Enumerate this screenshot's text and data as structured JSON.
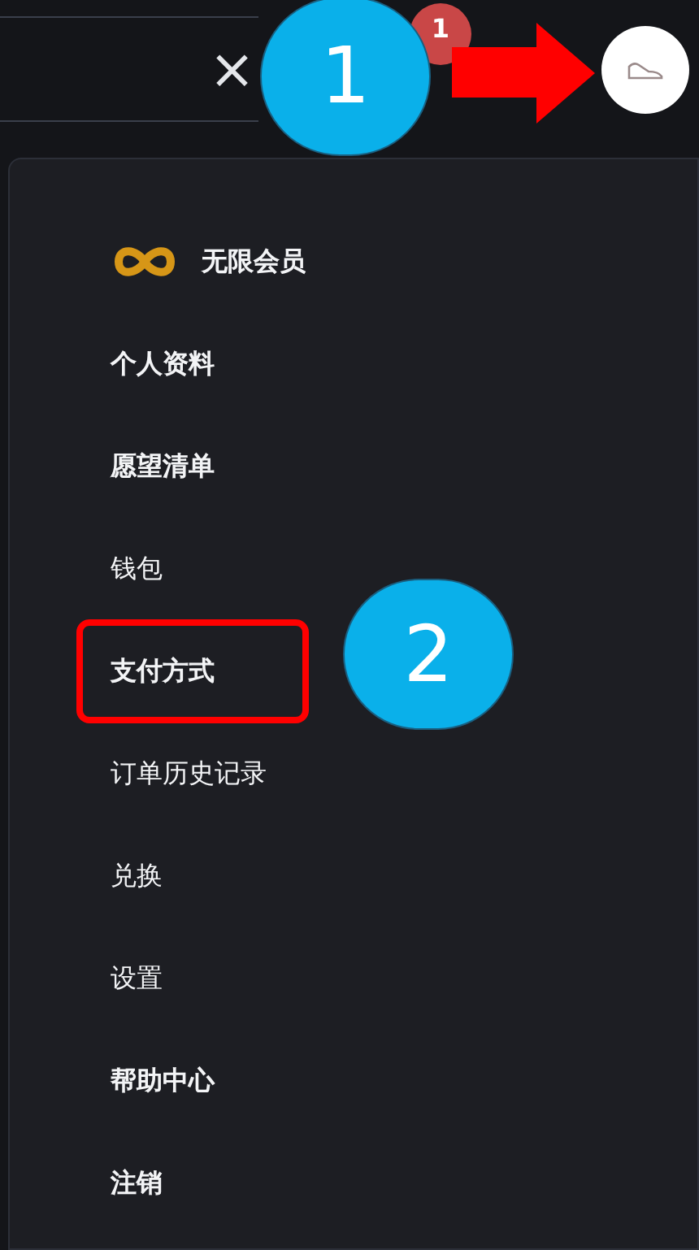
{
  "header": {
    "clear_icon": "×",
    "notification_badge": "1"
  },
  "menu": {
    "items": [
      {
        "kind": "membership",
        "label": "无限会员",
        "bold": true,
        "highlighted": false
      },
      {
        "kind": "link",
        "label": "个人资料",
        "bold": true,
        "highlighted": false
      },
      {
        "kind": "link",
        "label": "愿望清单",
        "bold": true,
        "highlighted": false
      },
      {
        "kind": "link",
        "label": "钱包",
        "bold": false,
        "highlighted": false
      },
      {
        "kind": "link",
        "label": "支付方式",
        "bold": true,
        "highlighted": true
      },
      {
        "kind": "link",
        "label": "订单历史记录",
        "bold": false,
        "highlighted": false
      },
      {
        "kind": "link",
        "label": "兑换",
        "bold": false,
        "highlighted": false
      },
      {
        "kind": "link",
        "label": "设置",
        "bold": false,
        "highlighted": false
      },
      {
        "kind": "link",
        "label": "帮助中心",
        "bold": true,
        "highlighted": false
      },
      {
        "kind": "link",
        "label": "注销",
        "bold": true,
        "highlighted": false
      }
    ]
  },
  "annotations": [
    {
      "label": "1"
    },
    {
      "label": "2"
    }
  ]
}
